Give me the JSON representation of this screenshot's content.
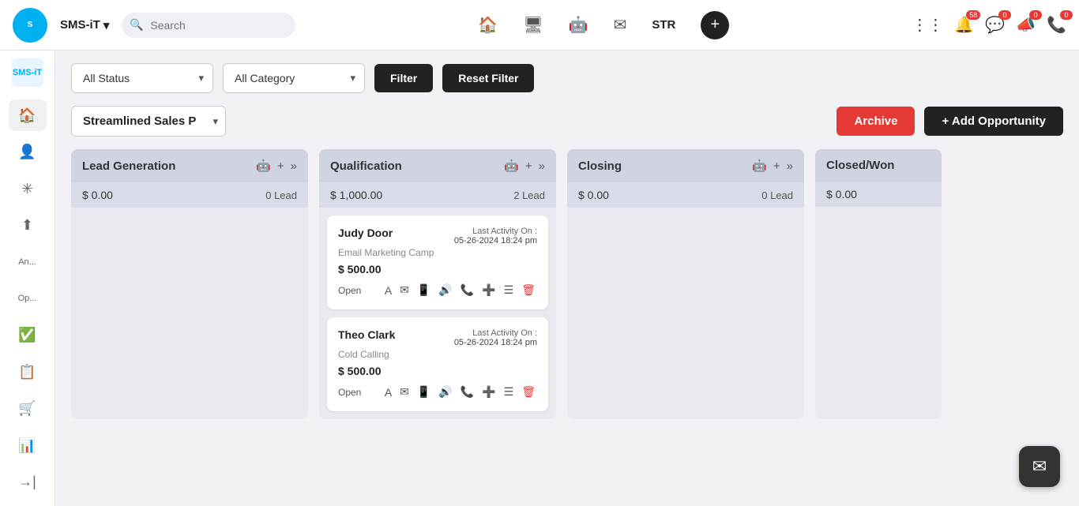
{
  "app": {
    "name": "SMS-iT",
    "chevron": "▾"
  },
  "search": {
    "placeholder": "Search"
  },
  "navbar": {
    "str_label": "STR",
    "icons": {
      "home": "🏠",
      "monitor": "🖥",
      "robot": "🤖",
      "mail": "✉"
    },
    "badges": [
      {
        "icon": "⋮⋮⋮",
        "count": null
      },
      {
        "icon": "🔔",
        "count": "58"
      },
      {
        "icon": "💬",
        "count": "0"
      },
      {
        "icon": "📣",
        "count": "0"
      },
      {
        "icon": "📞",
        "count": "0"
      }
    ]
  },
  "filters": {
    "status_label": "All Status",
    "category_label": "All Category",
    "filter_btn": "Filter",
    "reset_btn": "Reset Filter"
  },
  "pipeline": {
    "name": "Streamlined Sales P",
    "archive_btn": "Archive",
    "add_btn": "+ Add Opportunity"
  },
  "columns": [
    {
      "id": "lead-generation",
      "title": "Lead Generation",
      "amount": "$ 0.00",
      "lead_count": "0 Lead",
      "cards": []
    },
    {
      "id": "qualification",
      "title": "Qualification",
      "amount": "$ 1,000.00",
      "lead_count": "2 Lead",
      "cards": [
        {
          "name": "Judy Door",
          "source": "Email Marketing Camp",
          "activity_label": "Last Activity On :",
          "activity_date": "05-26-2024 18:24 pm",
          "amount": "$ 500.00",
          "status": "Open"
        },
        {
          "name": "Theo Clark",
          "source": "Cold Calling",
          "activity_label": "Last Activity On :",
          "activity_date": "05-26-2024 18:24 pm",
          "amount": "$ 500.00",
          "status": "Open"
        }
      ]
    },
    {
      "id": "closing",
      "title": "Closing",
      "amount": "$ 0.00",
      "lead_count": "0 Lead",
      "cards": []
    },
    {
      "id": "closed-won",
      "title": "Closed/Won",
      "amount": "$ 0.00",
      "lead_count": "",
      "cards": []
    }
  ],
  "sidebar": {
    "items": [
      {
        "icon": "🏠",
        "label": "",
        "active": true
      },
      {
        "icon": "👤",
        "label": ""
      },
      {
        "icon": "✳",
        "label": ""
      },
      {
        "icon": "⬆",
        "label": ""
      },
      {
        "icon": "An...",
        "label": "An..."
      },
      {
        "icon": "Op...",
        "label": "Op..."
      },
      {
        "icon": "✅",
        "label": ""
      },
      {
        "icon": "📋",
        "label": ""
      },
      {
        "icon": "🛒",
        "label": ""
      },
      {
        "icon": "📊",
        "label": ""
      },
      {
        "icon": "→|",
        "label": ""
      }
    ]
  },
  "float_chat": "✉"
}
